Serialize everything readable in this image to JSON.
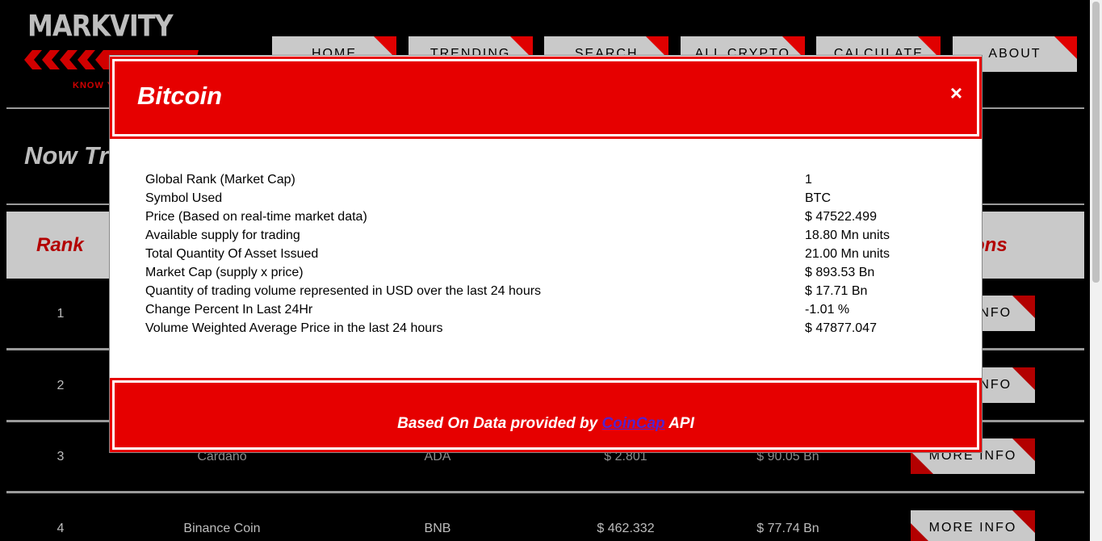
{
  "header": {
    "logo_text": "MARKVITY",
    "logo_tagline": "KNOW Y",
    "nav": [
      "HOME",
      "TRENDING",
      "SEARCH",
      "ALL CRYPTO",
      "CALCULATE",
      "ABOUT"
    ]
  },
  "section": {
    "title": "Now Tr"
  },
  "table": {
    "headers": {
      "rank": "Rank",
      "actions": "ons"
    },
    "rows": [
      {
        "rank": "1",
        "name": "",
        "symbol": "",
        "price": "",
        "cap": "",
        "action": "INFO"
      },
      {
        "rank": "2",
        "name": "",
        "symbol": "",
        "price": "",
        "cap": "",
        "action": "INFO"
      },
      {
        "rank": "3",
        "name": "Cardano",
        "symbol": "ADA",
        "price": "$ 2.801",
        "cap": "$ 90.05 Bn",
        "action": "MORE INFO"
      },
      {
        "rank": "4",
        "name": "Binance Coin",
        "symbol": "BNB",
        "price": "$ 462.332",
        "cap": "$ 77.74 Bn",
        "action": "MORE INFO"
      }
    ]
  },
  "modal": {
    "title": "Bitcoin",
    "close": "×",
    "rows": [
      {
        "label": "Global Rank (Market Cap)",
        "value": "1"
      },
      {
        "label": "Symbol Used",
        "value": "BTC"
      },
      {
        "label": "Price (Based on real-time market data)",
        "value": "$ 47522.499"
      },
      {
        "label": "Available supply for trading",
        "value": "18.80 Mn units"
      },
      {
        "label": "Total Quantity Of Asset Issued",
        "value": "21.00 Mn units"
      },
      {
        "label": "Market Cap (supply x price)",
        "value": "$ 893.53 Bn"
      },
      {
        "label": "Quantity of trading volume represented in USD over the last 24 hours",
        "value": "$ 17.71 Bn"
      },
      {
        "label": "Change Percent In Last 24Hr",
        "value": "-1.01 %"
      },
      {
        "label": "Volume Weighted Average Price in the last 24 hours",
        "value": "$ 47877.047"
      }
    ],
    "footer": {
      "prefix": "Based On Data provided by ",
      "link": "CoinCap",
      "suffix": " API"
    }
  },
  "colors": {
    "accent": "#e60000",
    "button": "#c9c9c9",
    "background": "#000000"
  }
}
